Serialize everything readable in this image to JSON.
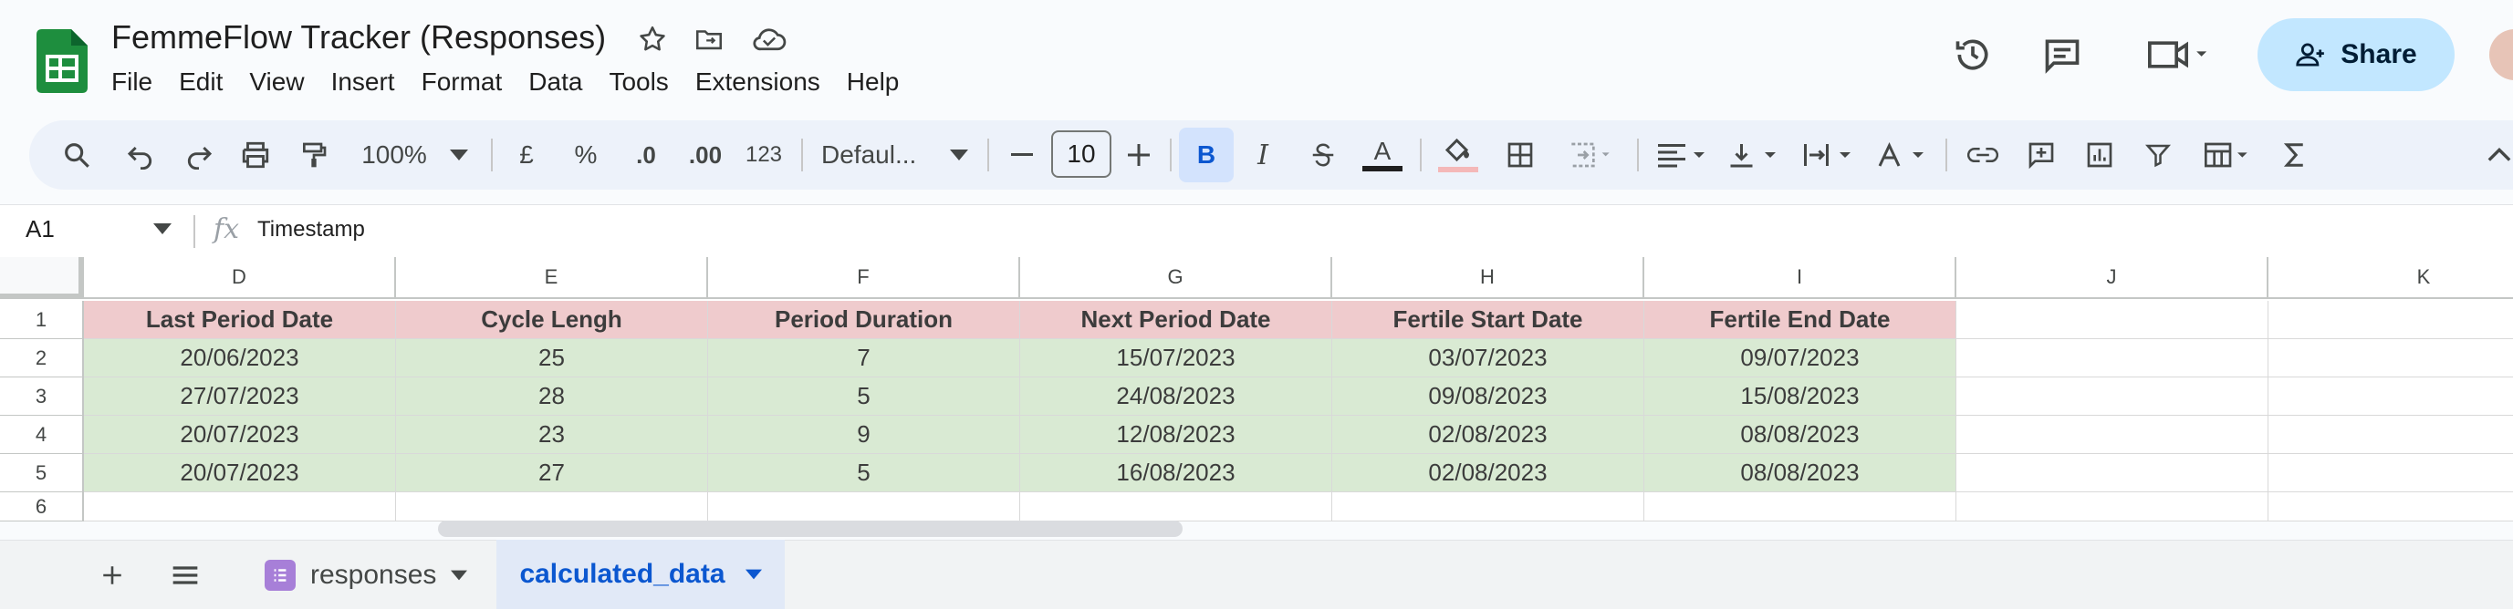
{
  "app": {
    "title": "FemmeFlow Tracker (Responses)",
    "menu": [
      "File",
      "Edit",
      "View",
      "Insert",
      "Format",
      "Data",
      "Tools",
      "Extensions",
      "Help"
    ],
    "share_label": "Share"
  },
  "toolbar": {
    "zoom": "100%",
    "currency": "£",
    "percent": "%",
    "dec_decrease": ".0",
    "dec_increase": ".00",
    "number_format": "123",
    "font": "Defaul...",
    "font_size": "10",
    "bold": "B",
    "italic": "I",
    "text_color": "A"
  },
  "formula_bar": {
    "cell_ref": "A1",
    "fx": "fx",
    "value": "Timestamp"
  },
  "grid": {
    "columns": [
      "D",
      "E",
      "F",
      "G",
      "H",
      "I",
      "J",
      "K"
    ],
    "rows": [
      "1",
      "2",
      "3",
      "4",
      "5",
      "6"
    ],
    "headers": [
      "Last Period Date",
      "Cycle Lengh",
      "Period Duration",
      "Next Period Date",
      "Fertile Start Date",
      "Fertile End Date"
    ],
    "data": [
      [
        "20/06/2023",
        "25",
        "7",
        "15/07/2023",
        "03/07/2023",
        "09/07/2023"
      ],
      [
        "27/07/2023",
        "28",
        "5",
        "24/08/2023",
        "09/08/2023",
        "15/08/2023"
      ],
      [
        "20/07/2023",
        "23",
        "9",
        "12/08/2023",
        "02/08/2023",
        "08/08/2023"
      ],
      [
        "20/07/2023",
        "27",
        "5",
        "16/08/2023",
        "02/08/2023",
        "08/08/2023"
      ]
    ]
  },
  "sheets": {
    "tabs": [
      {
        "label": "responses",
        "active": false
      },
      {
        "label": "calculated_data",
        "active": true
      }
    ]
  },
  "colors": {
    "header_fill": "#efcbcd",
    "data_fill": "#d9ead3",
    "accent": "#0b57d0",
    "share_bg": "#c2e7ff"
  }
}
